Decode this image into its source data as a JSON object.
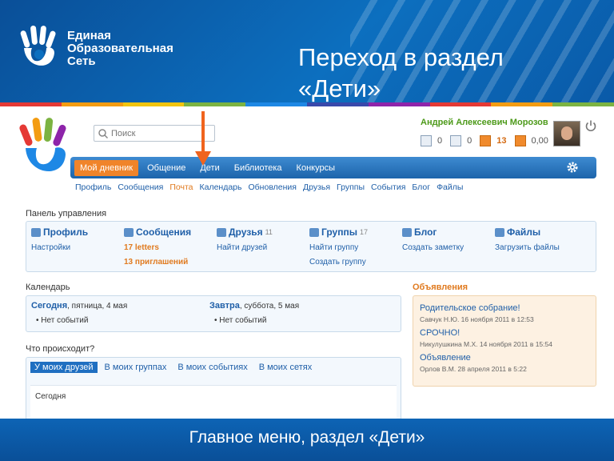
{
  "banner": {
    "brand_lines": [
      "Единая",
      "Образовательная",
      "Сеть"
    ],
    "title_line1": "Переход в раздел",
    "title_line2": "«Дети»"
  },
  "colors": {
    "brand_blue": "#0a4f98",
    "accent_orange": "#f0842a",
    "strip": [
      "#e53935",
      "#f39c12",
      "#f1c40f",
      "#7cb342",
      "#1e88e5",
      "#3949ab",
      "#8e24aa",
      "#e53935",
      "#f39c12",
      "#7cb342"
    ]
  },
  "search": {
    "placeholder": "Поиск"
  },
  "user": {
    "name": "Андрей Алексеевич Морозов",
    "counters": [
      {
        "icon": "mail-icon",
        "value": "0"
      },
      {
        "icon": "person-icon",
        "value": "0"
      },
      {
        "icon": "notification-icon",
        "value": "13"
      },
      {
        "icon": "wallet-icon",
        "value": "0,00"
      }
    ]
  },
  "mainnav": {
    "items": [
      "Мой дневник",
      "Общение",
      "Дети",
      "Библиотека",
      "Конкурсы"
    ],
    "active": "Мой дневник"
  },
  "subnav": {
    "items": [
      "Профиль",
      "Сообщения",
      "Почта",
      "Календарь",
      "Обновления",
      "Друзья",
      "Группы",
      "События",
      "Блог",
      "Файлы"
    ],
    "current": "Почта"
  },
  "control_panel": {
    "label": "Панель управления",
    "columns": [
      {
        "title": "Профиль",
        "count": "",
        "links": [
          "Настройки"
        ]
      },
      {
        "title": "Сообщения",
        "count": "",
        "links": [
          "17 letters",
          "13 приглашений"
        ]
      },
      {
        "title": "Друзья",
        "count": "11",
        "links": [
          "Найти друзей"
        ]
      },
      {
        "title": "Группы",
        "count": "17",
        "links": [
          "Найти группу",
          "Создать группу"
        ]
      },
      {
        "title": "Блог",
        "count": "",
        "links": [
          "Создать заметку"
        ]
      },
      {
        "title": "Файлы",
        "count": "",
        "links": [
          "Загрузить файлы"
        ]
      }
    ]
  },
  "calendar": {
    "label": "Календарь",
    "today": {
      "title": "Сегодня",
      "date": ", пятница, 4 мая",
      "item": "Нет событий"
    },
    "tomorrow": {
      "title": "Завтра",
      "date": ", суббота, 5 мая",
      "item": "Нет событий"
    }
  },
  "ads": {
    "label": "Объявления",
    "items": [
      {
        "title": "Родительское собрание!",
        "meta": "Савчук Н.Ю. 16 ноября 2011 в 12:53"
      },
      {
        "title": "СРОЧНО!",
        "meta": "Никулушкина М.Х. 14 ноября 2011 в 15:54"
      },
      {
        "title": "Объявление",
        "meta": "Орлов В.М. 28 апреля 2011 в 5:22"
      }
    ]
  },
  "activity": {
    "label": "Что происходит?",
    "tabs": [
      "У моих друзей",
      "В моих группах",
      "В моих событиях",
      "В моих сетях"
    ],
    "selected": "У моих друзей",
    "today": "Сегодня"
  },
  "footer": {
    "caption": "Главное меню, раздел «Дети»"
  }
}
